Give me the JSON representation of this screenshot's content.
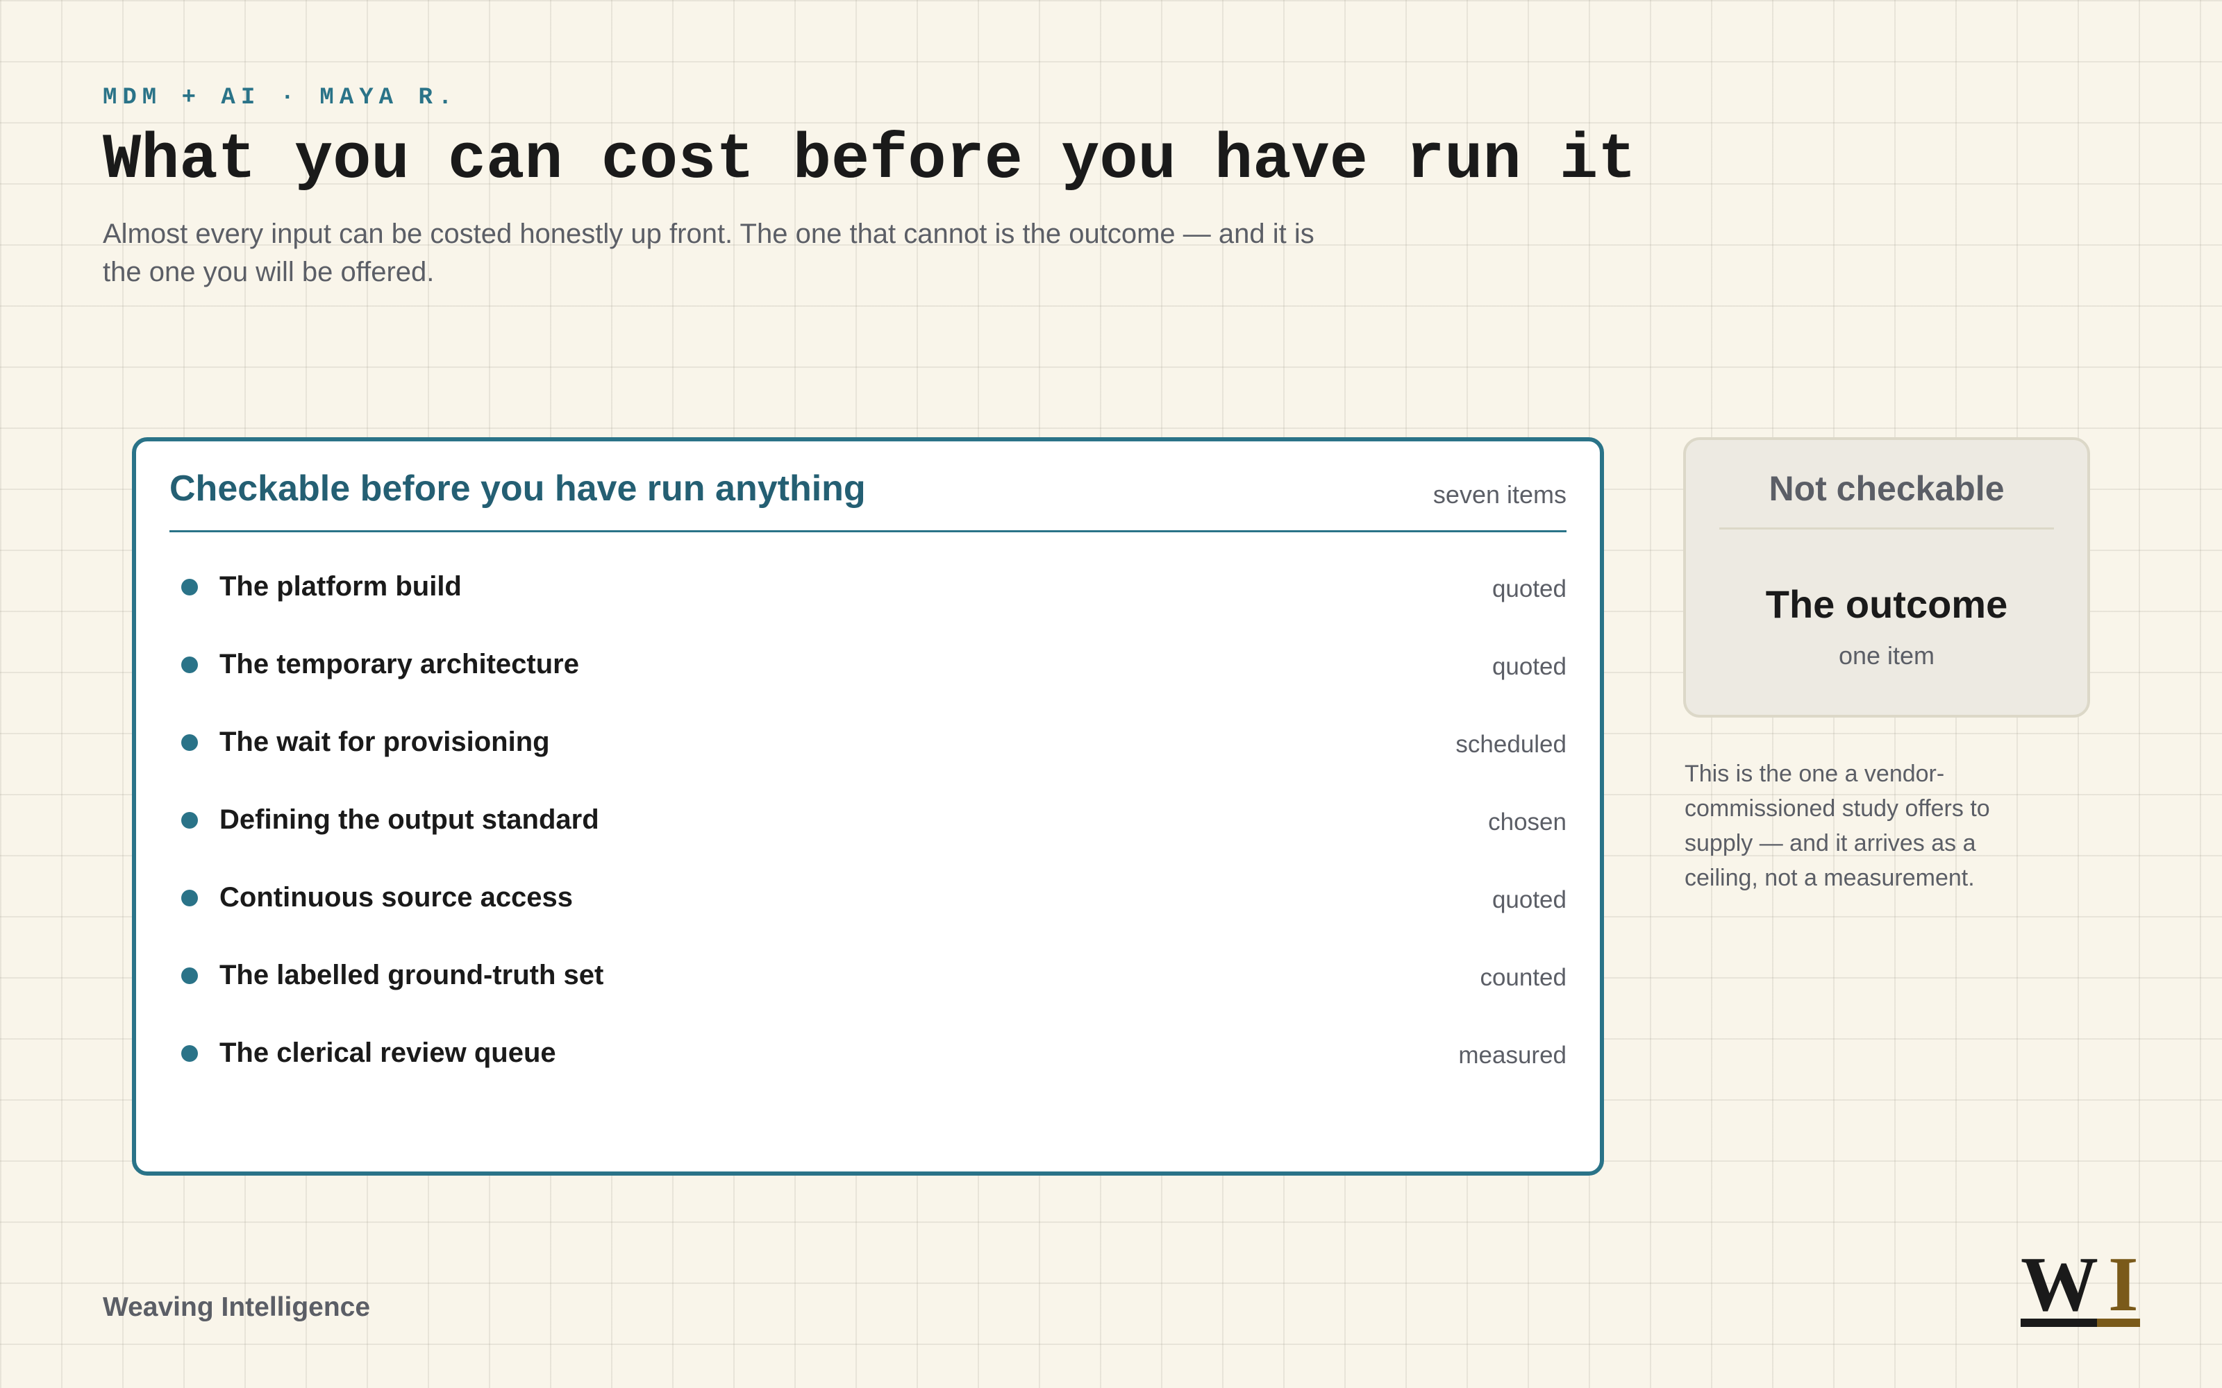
{
  "header": {
    "eyebrow": "MDM + AI · MAYA R.",
    "title": "What you can cost before you have run it",
    "subtitle": "Almost every input can be costed honestly up front. The one that cannot is the outcome — and it is the one you will be offered."
  },
  "checkable": {
    "title": "Checkable before you have run anything",
    "count": "seven items",
    "items": [
      {
        "label": "The platform build",
        "tag": "quoted"
      },
      {
        "label": "The temporary architecture",
        "tag": "quoted"
      },
      {
        "label": "The wait for provisioning",
        "tag": "scheduled"
      },
      {
        "label": "Defining the output standard",
        "tag": "chosen"
      },
      {
        "label": "Continuous source access",
        "tag": "quoted"
      },
      {
        "label": "The labelled ground-truth set",
        "tag": "counted"
      },
      {
        "label": "The clerical review queue",
        "tag": "measured"
      }
    ]
  },
  "not_checkable": {
    "title": "Not checkable",
    "item": "The outcome",
    "count": "one item",
    "note": "This is the one a vendor-commissioned study offers to supply — and it arrives as a ceiling, not a measurement."
  },
  "footer": {
    "brand": "Weaving Intelligence",
    "logo_letters": [
      "W",
      "I"
    ]
  },
  "colors": {
    "accent": "#2a7388",
    "accent_dark": "#245f73",
    "gold": "#7a5a1a",
    "ink": "#1a1a1a",
    "muted": "#5b5e66",
    "background": "#f9f5ea"
  },
  "icons": {
    "bullet": "dot-icon",
    "logo": "wi-logo"
  }
}
